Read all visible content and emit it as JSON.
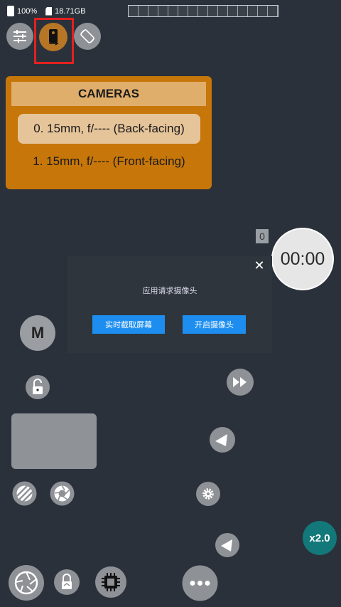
{
  "status_bar": {
    "battery": "100%",
    "storage": "18.71GB"
  },
  "top_controls": [
    "settings-icon",
    "camera-switch-icon",
    "auto-rotate-icon"
  ],
  "cameras_panel": {
    "title": "CAMERAS",
    "items": [
      {
        "label": "0. 15mm, f/---- (Back-facing)",
        "selected": true
      },
      {
        "label": "1. 15mm, f/---- (Front-facing)",
        "selected": false
      }
    ]
  },
  "timer": {
    "value": "00:00",
    "counter": "0"
  },
  "dialog": {
    "title": "应用请求摄像头",
    "buttons": [
      "实时截取屏幕",
      "开启摄像头"
    ]
  },
  "controls": {
    "mode_label": "M",
    "zoom_label": "x2.0"
  },
  "colors": {
    "background": "#2a313a",
    "accent_orange": "#c7760a",
    "dialog_button": "#1d8ef0",
    "zoom_teal": "#12787a",
    "highlight": "#e32020"
  }
}
